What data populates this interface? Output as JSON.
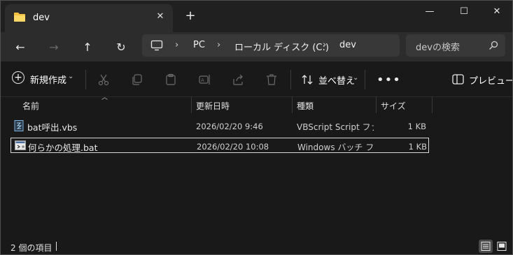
{
  "window": {
    "tab_title": "dev",
    "tab_close": "✕",
    "new_tab": "+",
    "minimize": "—",
    "maximize": "☐",
    "close": "✕",
    "tab_icon": "folder-icon"
  },
  "nav": {
    "back": "←",
    "forward": "→",
    "up": "↑",
    "refresh": "↻"
  },
  "address": {
    "icon": "computer-icon",
    "crumbs": [
      "PC",
      "ローカル ディスク (C:)",
      "dev"
    ],
    "separator": "›"
  },
  "search": {
    "placeholder": "devの検索",
    "icon": "search-icon"
  },
  "commands": {
    "new_label": "新規作成",
    "new_dropdown": "⌄",
    "sort_label": "並べ替え",
    "sort_dropdown": "⌄",
    "more": "•••",
    "preview_label": "プレビュー"
  },
  "columns": [
    {
      "label": "名前"
    },
    {
      "label": "更新日時"
    },
    {
      "label": "種類"
    },
    {
      "label": "サイズ"
    }
  ],
  "files": [
    {
      "name": "bat呼出.vbs",
      "date": "2026/02/20 9:46",
      "type": "VBScript Script ファ...",
      "size": "1 KB",
      "icon": "vbscript-file-icon",
      "selected": false
    },
    {
      "name": "何らかの処理.bat",
      "date": "2026/02/20 10:08",
      "type": "Windows バッチ ファ...",
      "size": "1 KB",
      "icon": "batch-file-icon",
      "selected": true
    }
  ],
  "status": {
    "item_count": "2 個の項目"
  },
  "colors": {
    "background": "#191919",
    "titlebar": "#202020",
    "toolbar": "#2c2c2c",
    "field": "#383838",
    "text": "#ffffff",
    "folder": "#f4c042"
  }
}
